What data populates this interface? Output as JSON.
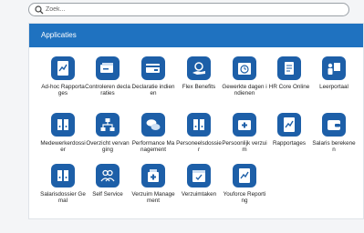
{
  "search": {
    "placeholder": "Zoek...",
    "value": ""
  },
  "panel": {
    "title": "Applicaties"
  },
  "tiles": [
    {
      "label": "Ad-hoc Rapportages",
      "icon": "chart-document-icon"
    },
    {
      "label": "Controleren declaraties",
      "icon": "card-reader-icon"
    },
    {
      "label": "Declaratie indienen",
      "icon": "card-submit-icon"
    },
    {
      "label": "Flex Benefits",
      "icon": "hand-coins-icon"
    },
    {
      "label": "Gewerkte dagen indienen",
      "icon": "calendar-clock-icon"
    },
    {
      "label": "HR Core Online",
      "icon": "scroll-icon"
    },
    {
      "label": "Leerportaal",
      "icon": "person-board-icon"
    },
    {
      "label": "Medewerkerdossier",
      "icon": "binders-icon"
    },
    {
      "label": "Overzicht vervanging",
      "icon": "org-chart-icon"
    },
    {
      "label": "Performance Management",
      "icon": "chat-bubbles-icon"
    },
    {
      "label": "Personeelsdossier",
      "icon": "binders-icon"
    },
    {
      "label": "Persoonlijk verzuim",
      "icon": "first-aid-icon"
    },
    {
      "label": "Rapportages",
      "icon": "chart-document-icon"
    },
    {
      "label": "Salaris berekenen",
      "icon": "wallet-icon"
    },
    {
      "label": "Salarisdossier Gemal",
      "icon": "binders-icon"
    },
    {
      "label": "Self Service",
      "icon": "people-icon"
    },
    {
      "label": "Verzuim Management",
      "icon": "medicine-icon"
    },
    {
      "label": "Verzuimtaken",
      "icon": "calendar-task-icon"
    },
    {
      "label": "Youforce Reporting",
      "icon": "chart-document-icon"
    }
  ]
}
